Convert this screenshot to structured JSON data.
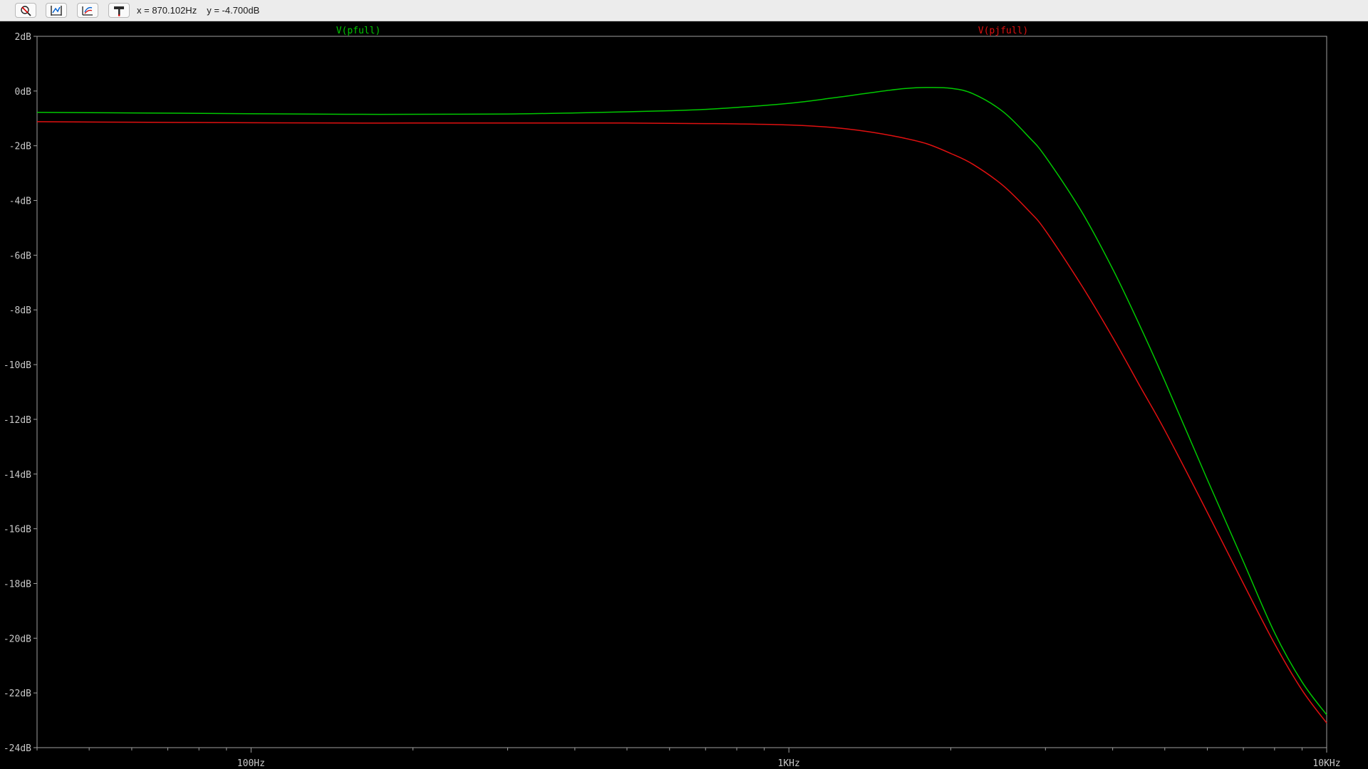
{
  "toolbar": {
    "buttons": [
      {
        "name": "zoom-cancel-icon"
      },
      {
        "name": "autorange-icon"
      },
      {
        "name": "axis-settings-icon"
      },
      {
        "name": "probe-icon"
      }
    ],
    "cursor": {
      "x_text": "x = 870.102Hz",
      "y_text": "y = -4.700dB"
    }
  },
  "colors": {
    "background": "#000000",
    "axis": "#a0a0a0",
    "label": "#c8c8c8",
    "series1": "#00c800",
    "series2": "#e01010"
  },
  "chart_data": {
    "type": "line",
    "xscale": "log",
    "xlim": [
      40,
      10000
    ],
    "ylim": [
      -24,
      2
    ],
    "y_ticks": [
      2,
      0,
      -2,
      -4,
      -6,
      -8,
      -10,
      -12,
      -14,
      -16,
      -18,
      -20,
      -22,
      -24
    ],
    "y_tick_labels": [
      "2dB",
      "0dB",
      "-2dB",
      "-4dB",
      "-6dB",
      "-8dB",
      "-10dB",
      "-12dB",
      "-14dB",
      "-16dB",
      "-18dB",
      "-20dB",
      "-22dB",
      "-24dB"
    ],
    "x_major_ticks": [
      100,
      1000,
      10000
    ],
    "x_tick_labels": [
      "100Hz",
      "1KHz",
      "10KHz"
    ],
    "series": [
      {
        "name": "V(pfull)",
        "color": "#00c800",
        "x": [
          40,
          60,
          100,
          150,
          200,
          300,
          400,
          500,
          600,
          700,
          800,
          1000,
          1200,
          1400,
          1600,
          1800,
          2000,
          2200,
          2500,
          2800,
          3000,
          3500,
          4000,
          4500,
          5000,
          6000,
          7000,
          8000,
          9000,
          10000
        ],
        "y": [
          -0.78,
          -0.8,
          -0.83,
          -0.85,
          -0.85,
          -0.84,
          -0.8,
          -0.76,
          -0.72,
          -0.67,
          -0.6,
          -0.45,
          -0.26,
          -0.08,
          0.07,
          0.13,
          0.1,
          -0.1,
          -0.75,
          -1.7,
          -2.4,
          -4.4,
          -6.5,
          -8.6,
          -10.6,
          -14.2,
          -17.2,
          -19.8,
          -21.6,
          -22.8
        ]
      },
      {
        "name": "V(pjfull)",
        "color": "#e01010",
        "x": [
          40,
          60,
          100,
          150,
          200,
          300,
          400,
          500,
          600,
          700,
          800,
          1000,
          1200,
          1400,
          1600,
          1800,
          2000,
          2200,
          2500,
          2800,
          3000,
          3500,
          4000,
          4500,
          5000,
          6000,
          7000,
          8000,
          9000,
          10000
        ],
        "y": [
          -1.12,
          -1.14,
          -1.16,
          -1.17,
          -1.17,
          -1.17,
          -1.17,
          -1.17,
          -1.18,
          -1.19,
          -1.2,
          -1.24,
          -1.33,
          -1.48,
          -1.68,
          -1.92,
          -2.28,
          -2.68,
          -3.45,
          -4.4,
          -5.1,
          -7.1,
          -9.0,
          -10.8,
          -12.4,
          -15.4,
          -18.0,
          -20.2,
          -21.9,
          -23.1
        ]
      }
    ]
  }
}
